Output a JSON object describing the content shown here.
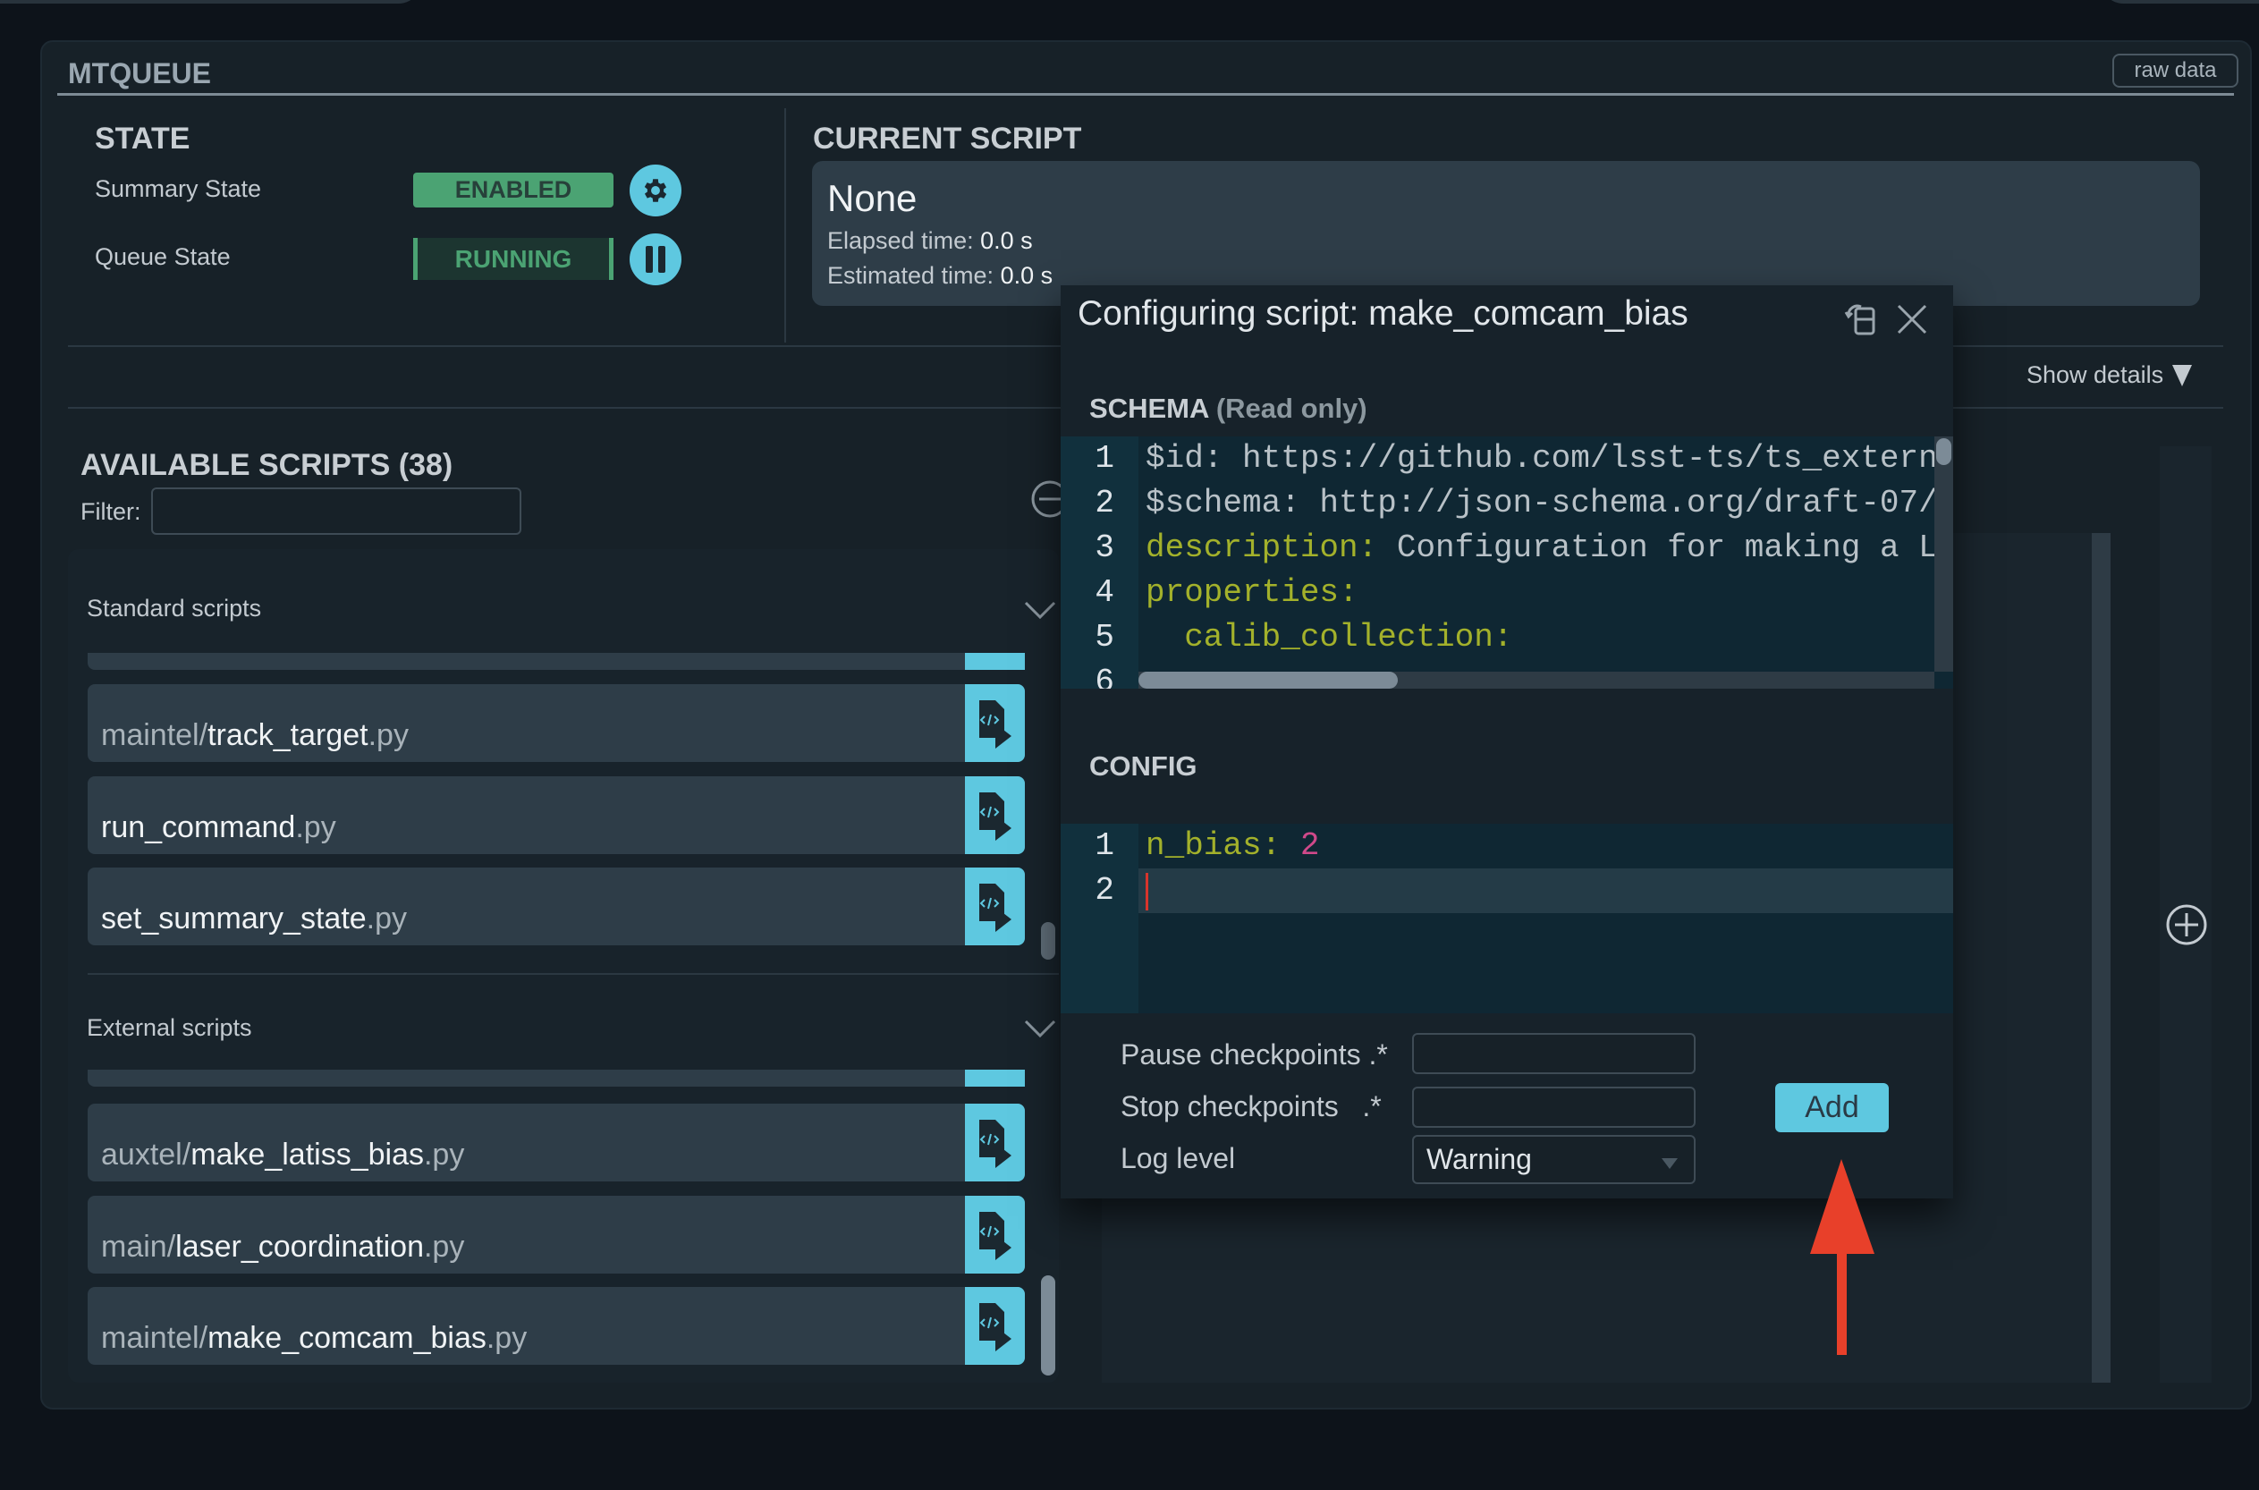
{
  "panel": {
    "title": "MTQUEUE",
    "raw_data_label": "raw data"
  },
  "state": {
    "heading": "STATE",
    "summary_label": "Summary State",
    "summary_value": "ENABLED",
    "queue_label": "Queue State",
    "queue_value": "RUNNING"
  },
  "current_script": {
    "heading": "CURRENT SCRIPT",
    "name": "None",
    "elapsed_label": "Elapsed time:",
    "elapsed_value": "0.0 s",
    "estimated_label": "Estimated time:",
    "estimated_value": "0.0 s",
    "show_details": "Show details"
  },
  "available": {
    "heading": "AVAILABLE SCRIPTS (38)",
    "filter_label": "Filter:",
    "filter_value": "",
    "standard": {
      "label": "Standard scripts",
      "items": [
        {
          "path": "maintel/",
          "name": "track_target",
          "ext": ".py"
        },
        {
          "path": "",
          "name": "run_command",
          "ext": ".py"
        },
        {
          "path": "",
          "name": "set_summary_state",
          "ext": ".py"
        }
      ]
    },
    "external": {
      "label": "External scripts",
      "items": [
        {
          "path": "auxtel/",
          "name": "make_latiss_bias",
          "ext": ".py"
        },
        {
          "path": "main/",
          "name": "laser_coordination",
          "ext": ".py"
        },
        {
          "path": "maintel/",
          "name": "make_comcam_bias",
          "ext": ".py"
        }
      ]
    }
  },
  "dialog": {
    "title": "Configuring script: make_comcam_bias",
    "schema_label": "SCHEMA",
    "schema_note": "(Read only)",
    "schema_lines": [
      {
        "n": "1",
        "key": "",
        "text": "$id: https://github.com/lsst-ts/ts_extern"
      },
      {
        "n": "2",
        "key": "",
        "text": "$schema: http://json-schema.org/draft-07/"
      },
      {
        "n": "3",
        "key": "description:",
        "text": " Configuration for making a L"
      },
      {
        "n": "4",
        "key": "properties:",
        "text": ""
      },
      {
        "n": "5",
        "key": "  calib_collection:",
        "text": ""
      },
      {
        "n": "6",
        "key": "",
        "text": ""
      }
    ],
    "config_label": "CONFIG",
    "config_lines": [
      {
        "n": "1",
        "key": "n_bias:",
        "value": " 2"
      },
      {
        "n": "2",
        "key": "",
        "value": ""
      }
    ],
    "pause_label": "Pause checkpoints",
    "pause_suffix": ".*",
    "pause_value": "",
    "stop_label": "Stop checkpoints",
    "stop_suffix": ".*",
    "stop_value": "",
    "log_label": "Log level",
    "log_value": "Warning",
    "add_label": "Add"
  },
  "colors": {
    "accent": "#5ec8e0",
    "enabled": "#4ba373",
    "annotation_arrow": "#e8402a"
  }
}
